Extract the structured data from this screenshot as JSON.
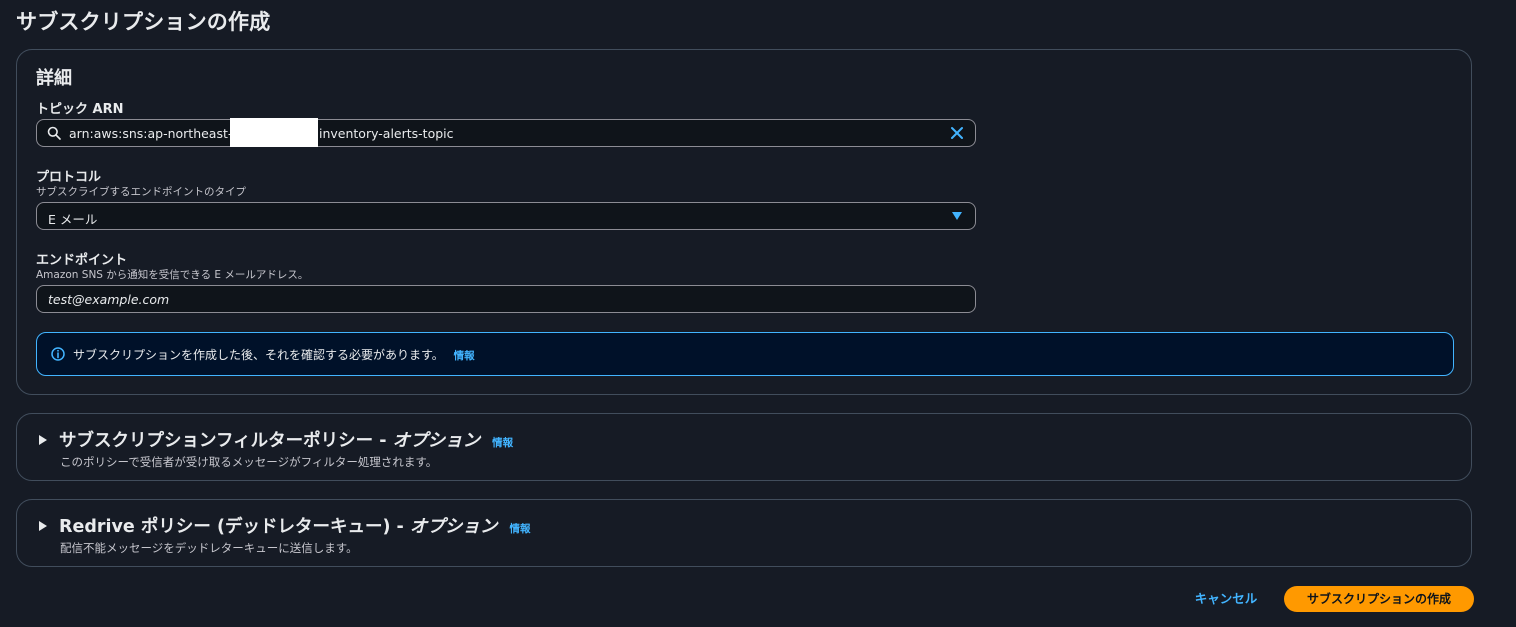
{
  "page": {
    "title": "サブスクリプションの作成"
  },
  "details": {
    "heading": "詳細",
    "topic_arn": {
      "label": "トピック ARN",
      "value_prefix": "arn:aws:sns:ap-northeast-1:1",
      "value_suffix": "inventory-alerts-topic"
    },
    "protocol": {
      "label": "プロトコル",
      "description": "サブスクライブするエンドポイントのタイプ",
      "selected": "E メール"
    },
    "endpoint": {
      "label": "エンドポイント",
      "description": "Amazon SNS から通知を受信できる E メールアドレス。",
      "placeholder": "test@example.com"
    },
    "alert": {
      "message": "サブスクリプションを作成した後、それを確認する必要があります。",
      "info_link": "情報"
    }
  },
  "filter_policy": {
    "title": "サブスクリプションフィルターポリシー - ",
    "optional": "オプション",
    "info_link": "情報",
    "description": "このポリシーで受信者が受け取るメッセージがフィルター処理されます。"
  },
  "redrive_policy": {
    "title": "Redrive ポリシー (デッドレターキュー) - ",
    "optional": "オプション",
    "info_link": "情報",
    "description": "配信不能メッセージをデッドレターキューに送信します。"
  },
  "footer": {
    "cancel_label": "キャンセル",
    "create_label": "サブスクリプションの作成"
  },
  "colors": {
    "background": "#161b25",
    "accent": "#42b4ff",
    "primary_button": "#ff9900",
    "border": "#414d5c"
  },
  "icons": [
    "search-icon",
    "close-icon",
    "caret-down-icon",
    "info-icon",
    "caret-right-icon"
  ]
}
